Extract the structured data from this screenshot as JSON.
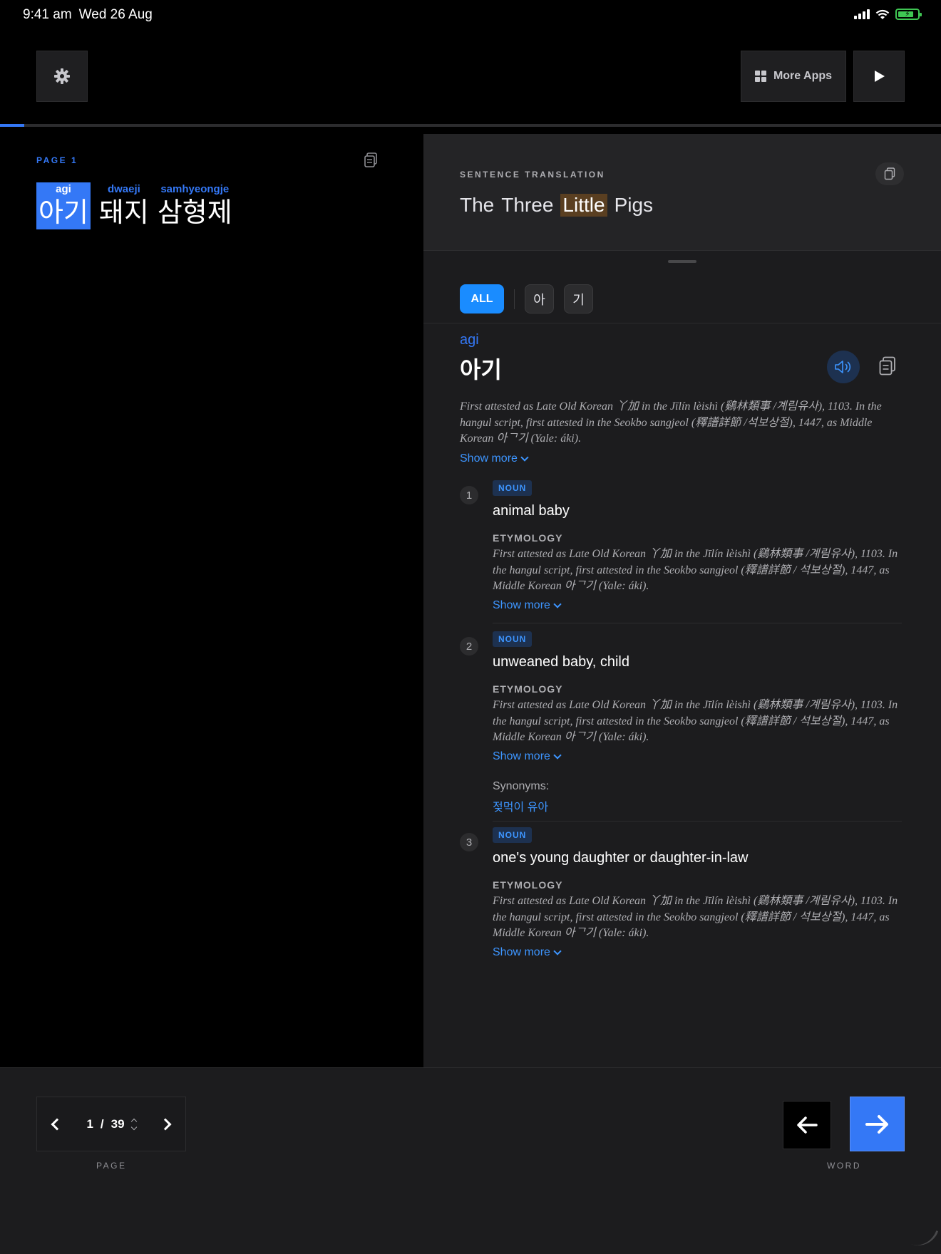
{
  "status_bar": {
    "time": "9:41 am",
    "date": "Wed 26 Aug"
  },
  "toolbar": {
    "more_apps_label": "More Apps"
  },
  "reader": {
    "page_label": "PAGE 1",
    "words": [
      {
        "romanization": "agi",
        "korean": "아기",
        "active": true
      },
      {
        "romanization": "dwaeji",
        "korean": "돼지",
        "active": false
      },
      {
        "romanization": "samhyeongje",
        "korean": "삼형제",
        "active": false
      }
    ]
  },
  "translation": {
    "label": "SENTENCE TRANSLATION",
    "words": [
      "The",
      "Three",
      "Little",
      "Pigs"
    ],
    "highlighted_index": 2
  },
  "filters": {
    "all_label": "ALL",
    "chips": [
      "아",
      "기"
    ]
  },
  "entry": {
    "romanization": "agi",
    "korean": "아기",
    "etymology": "First attested as Late Old Korean 丫加 in the Jīlín lèishì (鷄林類事 /계림유사), 1103. In the hangul script, first attested in the Seokbo sangjeol (釋譜詳節 /석보상절), 1447, as Middle Korean 아ᄀ기 (Yale: áki).",
    "show_more_label": "Show more",
    "senses": [
      {
        "number": "1",
        "pos": "NOUN",
        "gloss": "animal baby",
        "etymology_label": "ETYMOLOGY",
        "etymology": "First attested as Late Old Korean 丫加 in the Jīlín lèishì (鷄林類事 /계림유사), 1103. In the hangul script, first attested in the Seokbo sangjeol (釋譜詳節 / 석보상절), 1447, as Middle Korean 아ᄀ기 (Yale: áki).",
        "show_more_label": "Show more"
      },
      {
        "number": "2",
        "pos": "NOUN",
        "gloss": "unweaned baby, child",
        "etymology_label": "ETYMOLOGY",
        "etymology": "First attested as Late Old Korean 丫加 in the Jīlín lèishì (鷄林類事 /계림유사), 1103. In the hangul script, first attested in the Seokbo sangjeol (釋譜詳節 / 석보상절), 1447, as Middle Korean 아ᄀ기 (Yale: áki).",
        "show_more_label": "Show more",
        "synonyms_label": "Synonyms:",
        "synonyms": "젖먹이 유아"
      },
      {
        "number": "3",
        "pos": "NOUN",
        "gloss": "one's young daughter or daughter-in-law",
        "etymology_label": "ETYMOLOGY",
        "etymology": "First attested as Late Old Korean 丫加 in the Jīlín lèishì (鷄林類事 /계림유사), 1103. In the hangul script, first attested in the Seokbo sangjeol (釋譜詳節 / 석보상절), 1447, as Middle Korean 아ᄀ기 (Yale: áki).",
        "show_more_label": "Show more"
      }
    ]
  },
  "pager": {
    "current": "1",
    "separator": "/",
    "total": "39",
    "caption": "PAGE"
  },
  "word_nav": {
    "caption": "WORD"
  },
  "progress_fraction": 0.026,
  "colors": {
    "accent": "#3478f6",
    "link": "#3d95ff",
    "highlight": "#5a3f21",
    "panel": "#1c1c1e"
  }
}
